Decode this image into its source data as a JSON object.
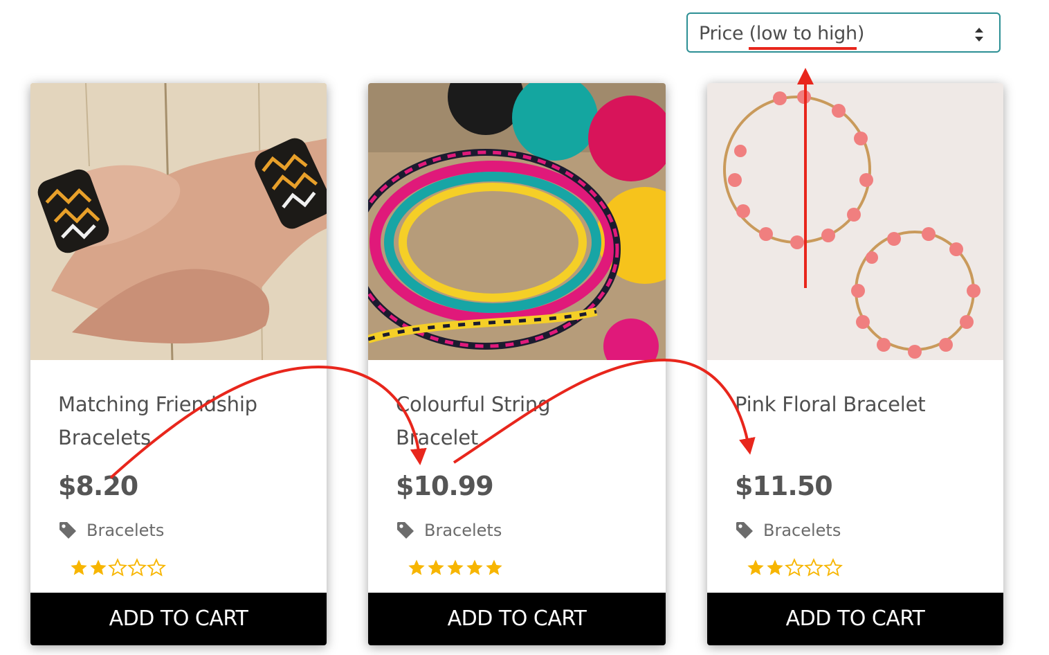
{
  "sort": {
    "selected": "Price (low to high)",
    "icon": "sort-updown-icon"
  },
  "products": [
    {
      "title": "Matching Friendship Bracelets",
      "price": "$8.20",
      "category": "Bracelets",
      "category_icon": "tag-icon",
      "rating": 2,
      "rating_max": 5,
      "button": "ADD TO CART"
    },
    {
      "title": "Colourful String Bracelet",
      "price": "$10.99",
      "category": "Bracelets",
      "category_icon": "tag-icon",
      "rating": 5,
      "rating_max": 5,
      "button": "ADD TO CART"
    },
    {
      "title": "Pink Floral Bracelet",
      "price": "$11.50",
      "category": "Bracelets",
      "category_icon": "tag-icon",
      "rating": 2,
      "rating_max": 5,
      "button": "ADD TO CART"
    }
  ],
  "colors": {
    "accent_border": "#2c8f94",
    "annotation": "#e8261c",
    "star": "#f7b500",
    "button_bg": "#000000"
  }
}
